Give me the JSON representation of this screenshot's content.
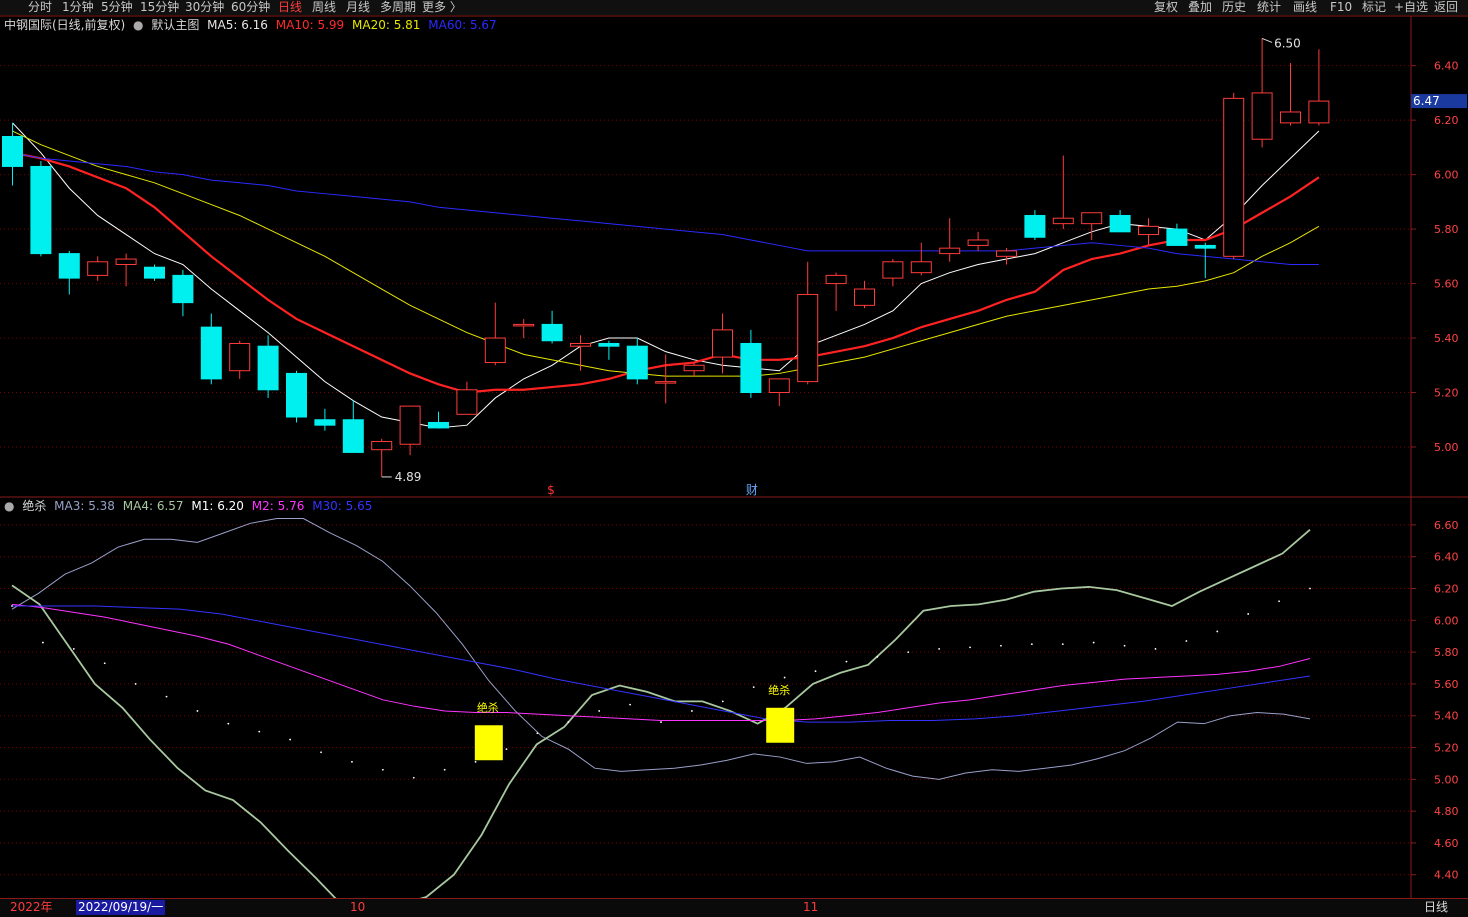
{
  "toolbar": {
    "left_tabs": [
      "分时",
      "1分钟",
      "5分钟",
      "15分钟",
      "30分钟",
      "60分钟",
      "日线",
      "周线",
      "月线",
      "多周期",
      "更多 〉"
    ],
    "active_tab": "日线",
    "right_buttons": [
      "复权",
      "叠加",
      "历史",
      "统计",
      "画线",
      "F10",
      "标记",
      "+自选",
      "返回"
    ]
  },
  "main_panel": {
    "security": "中钢国际(日线,前复权)",
    "template": "默认主图",
    "indicators": [
      {
        "label": "MA5: 6.16",
        "color": "#e6e6e6"
      },
      {
        "label": "MA10: 5.99",
        "color": "#ff2a2a"
      },
      {
        "label": "MA20: 5.81",
        "color": "#e6e600"
      },
      {
        "label": "MA60: 5.67",
        "color": "#2a2aff"
      }
    ],
    "current_price_tag": "6.47",
    "high_annotation": "6.50",
    "low_annotation": "4.89",
    "event_markers": [
      {
        "text": "$",
        "color": "#ff3333",
        "index": 19
      },
      {
        "text": "财",
        "color": "#66aaff",
        "index": 26
      }
    ]
  },
  "sub_panel": {
    "name": "绝杀",
    "indicators": [
      {
        "label": "MA3: 5.38",
        "color": "#9aa0c8"
      },
      {
        "label": "MA4: 6.57",
        "color": "#a8c8a0"
      },
      {
        "label": "M1: 6.20",
        "color": "#ffffff"
      },
      {
        "label": "M2: 5.76",
        "color": "#ff33ff"
      },
      {
        "label": "M30: 5.65",
        "color": "#3333ff"
      }
    ],
    "signal_label": "绝杀",
    "signal_color": "#ffff00"
  },
  "bottom_bar": {
    "year": "2022年",
    "cursor_date": "2022/09/19/一",
    "month_10": "10",
    "month_11": "11",
    "period": "日线"
  },
  "chart_data": [
    {
      "type": "candlestick",
      "title": "中钢国际(日线,前复权)",
      "ylim": [
        4.82,
        6.52
      ],
      "y_ticks": [
        5.0,
        5.2,
        5.4,
        5.6,
        5.8,
        6.0,
        6.2,
        6.4
      ],
      "candles": [
        {
          "o": 6.14,
          "h": 6.19,
          "l": 5.96,
          "c": 6.03
        },
        {
          "o": 6.03,
          "h": 6.05,
          "l": 5.7,
          "c": 5.71
        },
        {
          "o": 5.71,
          "h": 5.72,
          "l": 5.56,
          "c": 5.62
        },
        {
          "o": 5.63,
          "h": 5.7,
          "l": 5.61,
          "c": 5.68
        },
        {
          "o": 5.67,
          "h": 5.71,
          "l": 5.59,
          "c": 5.69
        },
        {
          "o": 5.66,
          "h": 5.67,
          "l": 5.61,
          "c": 5.62
        },
        {
          "o": 5.63,
          "h": 5.65,
          "l": 5.48,
          "c": 5.53
        },
        {
          "o": 5.44,
          "h": 5.49,
          "l": 5.23,
          "c": 5.25
        },
        {
          "o": 5.28,
          "h": 5.39,
          "l": 5.25,
          "c": 5.38
        },
        {
          "o": 5.37,
          "h": 5.41,
          "l": 5.18,
          "c": 5.21
        },
        {
          "o": 5.27,
          "h": 5.28,
          "l": 5.09,
          "c": 5.11
        },
        {
          "o": 5.1,
          "h": 5.14,
          "l": 5.06,
          "c": 5.08
        },
        {
          "o": 5.1,
          "h": 5.17,
          "l": 4.98,
          "c": 4.98
        },
        {
          "o": 4.99,
          "h": 5.03,
          "l": 4.89,
          "c": 5.02
        },
        {
          "o": 5.01,
          "h": 5.15,
          "l": 4.97,
          "c": 5.15
        },
        {
          "o": 5.09,
          "h": 5.13,
          "l": 5.07,
          "c": 5.07
        },
        {
          "o": 5.12,
          "h": 5.24,
          "l": 5.12,
          "c": 5.21
        },
        {
          "o": 5.31,
          "h": 5.53,
          "l": 5.3,
          "c": 5.4
        },
        {
          "o": 5.45,
          "h": 5.47,
          "l": 5.4,
          "c": 5.45
        },
        {
          "o": 5.45,
          "h": 5.5,
          "l": 5.38,
          "c": 5.39
        },
        {
          "o": 5.37,
          "h": 5.41,
          "l": 5.28,
          "c": 5.38
        },
        {
          "o": 5.38,
          "h": 5.39,
          "l": 5.32,
          "c": 5.37
        },
        {
          "o": 5.37,
          "h": 5.4,
          "l": 5.23,
          "c": 5.25
        },
        {
          "o": 5.24,
          "h": 5.34,
          "l": 5.16,
          "c": 5.24
        },
        {
          "o": 5.28,
          "h": 5.31,
          "l": 5.26,
          "c": 5.3
        },
        {
          "o": 5.33,
          "h": 5.49,
          "l": 5.27,
          "c": 5.43
        },
        {
          "o": 5.38,
          "h": 5.43,
          "l": 5.18,
          "c": 5.2
        },
        {
          "o": 5.2,
          "h": 5.25,
          "l": 5.15,
          "c": 5.25
        },
        {
          "o": 5.24,
          "h": 5.68,
          "l": 5.23,
          "c": 5.56
        },
        {
          "o": 5.6,
          "h": 5.64,
          "l": 5.5,
          "c": 5.63
        },
        {
          "o": 5.52,
          "h": 5.61,
          "l": 5.51,
          "c": 5.58
        },
        {
          "o": 5.62,
          "h": 5.69,
          "l": 5.59,
          "c": 5.68
        },
        {
          "o": 5.64,
          "h": 5.75,
          "l": 5.63,
          "c": 5.68
        },
        {
          "o": 5.71,
          "h": 5.84,
          "l": 5.68,
          "c": 5.73
        },
        {
          "o": 5.74,
          "h": 5.79,
          "l": 5.72,
          "c": 5.76
        },
        {
          "o": 5.7,
          "h": 5.73,
          "l": 5.67,
          "c": 5.72
        },
        {
          "o": 5.85,
          "h": 5.87,
          "l": 5.76,
          "c": 5.77
        },
        {
          "o": 5.82,
          "h": 6.07,
          "l": 5.8,
          "c": 5.84
        },
        {
          "o": 5.82,
          "h": 5.86,
          "l": 5.76,
          "c": 5.86
        },
        {
          "o": 5.85,
          "h": 5.87,
          "l": 5.79,
          "c": 5.79
        },
        {
          "o": 5.78,
          "h": 5.84,
          "l": 5.74,
          "c": 5.81
        },
        {
          "o": 5.8,
          "h": 5.82,
          "l": 5.75,
          "c": 5.74
        },
        {
          "o": 5.74,
          "h": 5.75,
          "l": 5.62,
          "c": 5.73
        },
        {
          "o": 5.7,
          "h": 6.3,
          "l": 5.69,
          "c": 6.28
        },
        {
          "o": 6.13,
          "h": 6.5,
          "l": 6.1,
          "c": 6.3
        },
        {
          "o": 6.19,
          "h": 6.41,
          "l": 6.18,
          "c": 6.23
        },
        {
          "o": 6.19,
          "h": 6.46,
          "l": 6.18,
          "c": 6.27
        }
      ],
      "series": [
        {
          "name": "MA5",
          "color": "#ffffff",
          "values": [
            6.19,
            6.08,
            5.95,
            5.85,
            5.78,
            5.71,
            5.67,
            5.58,
            5.5,
            5.42,
            5.33,
            5.24,
            5.17,
            5.11,
            5.09,
            5.07,
            5.08,
            5.18,
            5.25,
            5.3,
            5.37,
            5.4,
            5.4,
            5.35,
            5.32,
            5.3,
            5.29,
            5.28,
            5.37,
            5.41,
            5.45,
            5.5,
            5.6,
            5.64,
            5.67,
            5.69,
            5.71,
            5.75,
            5.79,
            5.82,
            5.81,
            5.8,
            5.76,
            5.85,
            5.96,
            6.06,
            6.16
          ]
        },
        {
          "name": "MA10",
          "color": "#ff2222",
          "values": [
            6.08,
            6.06,
            6.03,
            5.99,
            5.95,
            5.88,
            5.79,
            5.7,
            5.62,
            5.54,
            5.47,
            5.42,
            5.37,
            5.32,
            5.27,
            5.23,
            5.2,
            5.21,
            5.21,
            5.22,
            5.23,
            5.25,
            5.28,
            5.3,
            5.31,
            5.34,
            5.32,
            5.32,
            5.33,
            5.35,
            5.37,
            5.4,
            5.44,
            5.47,
            5.5,
            5.54,
            5.57,
            5.65,
            5.69,
            5.71,
            5.74,
            5.76,
            5.76,
            5.8,
            5.86,
            5.92,
            5.99
          ]
        },
        {
          "name": "MA20",
          "color": "#e6e600",
          "values": [
            6.16,
            6.11,
            6.07,
            6.03,
            6.0,
            5.97,
            5.93,
            5.89,
            5.85,
            5.8,
            5.75,
            5.7,
            5.64,
            5.58,
            5.52,
            5.47,
            5.42,
            5.38,
            5.34,
            5.32,
            5.3,
            5.28,
            5.27,
            5.26,
            5.26,
            5.26,
            5.26,
            5.27,
            5.29,
            5.31,
            5.33,
            5.36,
            5.39,
            5.42,
            5.45,
            5.48,
            5.5,
            5.52,
            5.54,
            5.56,
            5.58,
            5.59,
            5.61,
            5.64,
            5.7,
            5.75,
            5.81
          ]
        },
        {
          "name": "MA60",
          "color": "#2a2aff",
          "values": [
            6.08,
            6.06,
            6.05,
            6.04,
            6.03,
            6.01,
            6.0,
            5.98,
            5.97,
            5.96,
            5.94,
            5.93,
            5.92,
            5.91,
            5.9,
            5.88,
            5.87,
            5.86,
            5.85,
            5.84,
            5.83,
            5.82,
            5.81,
            5.8,
            5.79,
            5.78,
            5.76,
            5.74,
            5.72,
            5.72,
            5.72,
            5.72,
            5.72,
            5.72,
            5.72,
            5.72,
            5.73,
            5.74,
            5.75,
            5.74,
            5.73,
            5.71,
            5.7,
            5.69,
            5.68,
            5.67,
            5.67
          ]
        }
      ]
    },
    {
      "type": "line",
      "title": "绝杀",
      "ylim": [
        4.26,
        6.7
      ],
      "y_ticks": [
        4.4,
        4.6,
        4.8,
        5.0,
        5.2,
        5.4,
        5.6,
        5.8,
        6.0,
        6.2,
        6.4,
        6.6
      ],
      "series": [
        {
          "name": "MA3",
          "color": "#9aa0c8",
          "values": [
            6.07,
            6.17,
            6.29,
            6.36,
            6.46,
            6.51,
            6.51,
            6.49,
            6.55,
            6.61,
            6.64,
            6.64,
            6.55,
            6.47,
            6.37,
            6.22,
            6.05,
            5.85,
            5.62,
            5.43,
            5.27,
            5.19,
            5.07,
            5.05,
            5.06,
            5.07,
            5.09,
            5.12,
            5.16,
            5.14,
            5.1,
            5.11,
            5.14,
            5.07,
            5.02,
            5.0,
            5.04,
            5.06,
            5.05,
            5.07,
            5.09,
            5.13,
            5.18,
            5.26,
            5.36,
            5.35,
            5.4,
            5.42,
            5.41,
            5.38
          ]
        },
        {
          "name": "MA4",
          "color": "#a8c8a0",
          "values": [
            6.22,
            6.1,
            5.85,
            5.6,
            5.45,
            5.25,
            5.07,
            4.93,
            4.87,
            4.73,
            4.55,
            4.38,
            4.2,
            4.2,
            4.21,
            4.26,
            4.4,
            4.65,
            4.97,
            5.22,
            5.33,
            5.53,
            5.59,
            5.55,
            5.49,
            5.49,
            5.43,
            5.35,
            5.45,
            5.6,
            5.67,
            5.72,
            5.88,
            6.06,
            6.09,
            6.1,
            6.13,
            6.18,
            6.2,
            6.21,
            6.19,
            6.14,
            6.09,
            6.18,
            6.26,
            6.34,
            6.42,
            6.57
          ]
        },
        {
          "name": "M2",
          "color": "#ff33ff",
          "values": [
            6.1,
            6.08,
            6.05,
            6.02,
            5.98,
            5.94,
            5.9,
            5.85,
            5.78,
            5.71,
            5.64,
            5.57,
            5.5,
            5.46,
            5.43,
            5.42,
            5.42,
            5.41,
            5.4,
            5.39,
            5.38,
            5.37,
            5.37,
            5.37,
            5.37,
            5.37,
            5.38,
            5.4,
            5.42,
            5.45,
            5.48,
            5.5,
            5.53,
            5.56,
            5.59,
            5.61,
            5.63,
            5.64,
            5.65,
            5.66,
            5.68,
            5.71,
            5.76
          ]
        },
        {
          "name": "M30",
          "color": "#3333ff",
          "values": [
            6.09,
            6.09,
            6.09,
            6.08,
            6.07,
            6.04,
            5.99,
            5.94,
            5.89,
            5.84,
            5.79,
            5.74,
            5.69,
            5.63,
            5.58,
            5.53,
            5.48,
            5.43,
            5.38,
            5.36,
            5.36,
            5.37,
            5.37,
            5.38,
            5.4,
            5.43,
            5.46,
            5.49,
            5.53,
            5.57,
            5.61,
            5.65
          ]
        },
        {
          "name": "M1",
          "color": "#ffffff",
          "values": [
            6.09,
            5.86,
            5.82,
            5.73,
            5.6,
            5.52,
            5.43,
            5.35,
            5.3,
            5.25,
            5.17,
            5.11,
            5.06,
            5.01,
            5.06,
            5.11,
            5.19,
            5.29,
            5.36,
            5.43,
            5.47,
            5.36,
            5.43,
            5.49,
            5.58,
            5.64,
            5.68,
            5.74,
            5.77,
            5.8,
            5.82,
            5.83,
            5.84,
            5.85,
            5.85,
            5.86,
            5.84,
            5.82,
            5.87,
            5.93,
            6.04,
            6.12,
            6.2
          ]
        }
      ],
      "signals": [
        {
          "index": 18,
          "label": "绝杀",
          "low": 5.12,
          "high": 5.34
        },
        {
          "index": 29,
          "label": "绝杀",
          "low": 5.23,
          "high": 5.45
        }
      ]
    }
  ],
  "styling": {
    "bg": "#000000",
    "grid": "#7a0000",
    "axis": "#8b1a1a",
    "tick_text": "#ff4444",
    "up_candle": "#ff3b3b",
    "down_candle": "#00f0f0"
  }
}
